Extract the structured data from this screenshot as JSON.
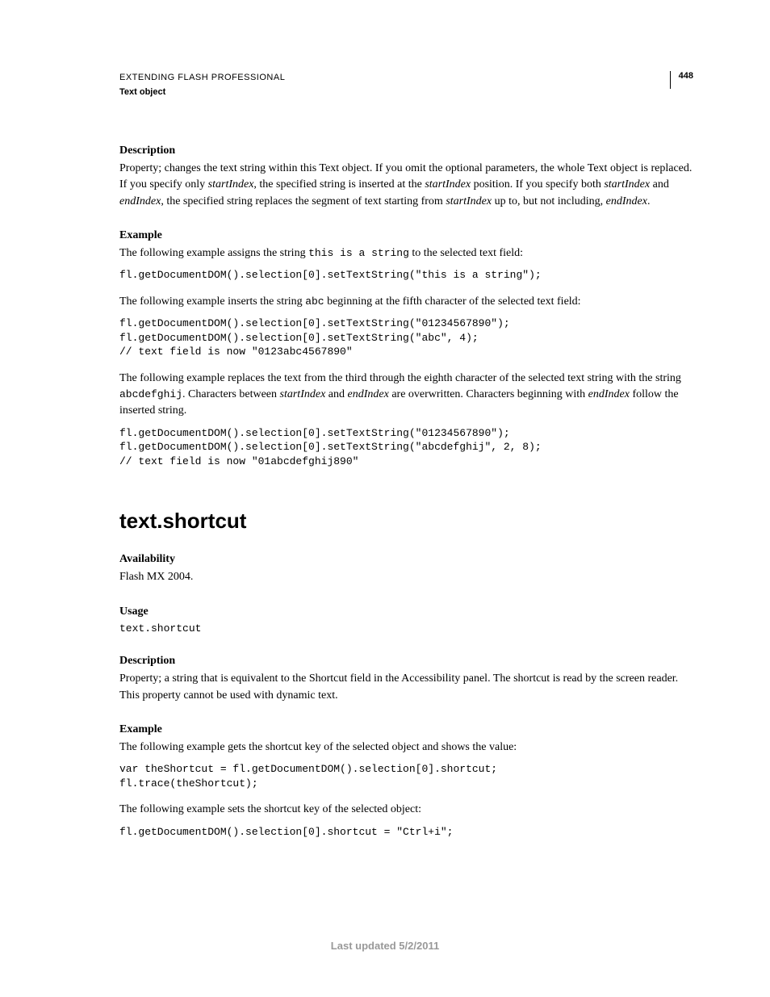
{
  "header": {
    "title": "EXTENDING FLASH PROFESSIONAL",
    "subtitle": "Text object",
    "page_number": "448"
  },
  "section1": {
    "desc_heading": "Description",
    "desc_p1_a": "Property; changes the text string within this Text object. If you omit the optional parameters, the whole Text object is replaced. If you specify only ",
    "desc_p1_b": "startIndex",
    "desc_p1_c": ", the specified string is inserted at the ",
    "desc_p1_d": "startIndex",
    "desc_p1_e": " position. If you specify both ",
    "desc_p1_f": "startIndex",
    "desc_p1_g": " and ",
    "desc_p1_h": "endIndex",
    "desc_p1_i": ", the specified string replaces the segment of text starting from ",
    "desc_p1_j": "startIndex",
    "desc_p1_k": " up to, but not including, ",
    "desc_p1_l": "endIndex",
    "desc_p1_m": ".",
    "example_heading": "Example",
    "ex_p1_a": "The following example assigns the string ",
    "ex_p1_b": "this is a string",
    "ex_p1_c": " to the selected text field:",
    "code1": "fl.getDocumentDOM().selection[0].setTextString(\"this is a string\");",
    "ex_p2_a": "The following example inserts the string ",
    "ex_p2_b": "abc",
    "ex_p2_c": " beginning at the fifth character of the selected text field:",
    "code2": "fl.getDocumentDOM().selection[0].setTextString(\"01234567890\");\nfl.getDocumentDOM().selection[0].setTextString(\"abc\", 4);\n// text field is now \"0123abc4567890\"",
    "ex_p3_a": "The following example replaces the text from the third through the eighth character of the selected text string with the string ",
    "ex_p3_b": "abcdefghij",
    "ex_p3_c": ". Characters between ",
    "ex_p3_d": "startIndex",
    "ex_p3_e": " and ",
    "ex_p3_f": "endIndex",
    "ex_p3_g": " are overwritten. Characters beginning with ",
    "ex_p3_h": "endIndex",
    "ex_p3_i": " follow the inserted string.",
    "code3": "fl.getDocumentDOM().selection[0].setTextString(\"01234567890\");\nfl.getDocumentDOM().selection[0].setTextString(\"abcdefghij\", 2, 8);\n// text field is now \"01abcdefghij890\""
  },
  "section2": {
    "title": "text.shortcut",
    "avail_heading": "Availability",
    "avail_text": "Flash MX 2004.",
    "usage_heading": "Usage",
    "usage_code": "text.shortcut",
    "desc_heading": "Description",
    "desc_text": "Property; a string that is equivalent to the Shortcut field in the Accessibility panel. The shortcut is read by the screen reader. This property cannot be used with dynamic text.",
    "example_heading": "Example",
    "ex_p1": "The following example gets the shortcut key of the selected object and shows the value:",
    "code1": "var theShortcut = fl.getDocumentDOM().selection[0].shortcut;\nfl.trace(theShortcut);",
    "ex_p2": "The following example sets the shortcut key of the selected object:",
    "code2": "fl.getDocumentDOM().selection[0].shortcut = \"Ctrl+i\";"
  },
  "footer": {
    "last_updated": "Last updated 5/2/2011"
  }
}
